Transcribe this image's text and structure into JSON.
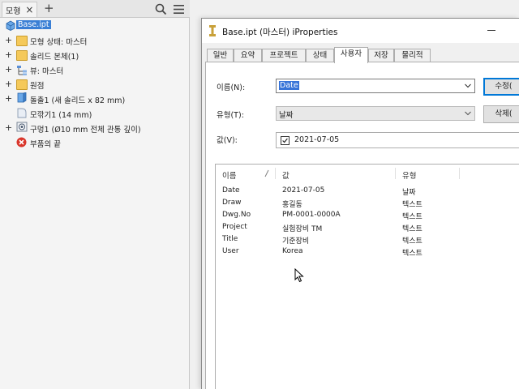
{
  "browser": {
    "tab_label": "모형",
    "close_glyph": "×",
    "add_glyph": "+",
    "tree": [
      {
        "label": "Base.ipt",
        "icon": "part-icon",
        "expander": ""
      },
      {
        "label": "모형 상태: 마스터",
        "icon": "folder-icon",
        "expander": "+"
      },
      {
        "label": "솔리드 본체(1)",
        "icon": "folder-icon",
        "expander": "+"
      },
      {
        "label": "뷰: 마스터",
        "icon": "view-icon",
        "expander": "+"
      },
      {
        "label": "원점",
        "icon": "folder-icon",
        "expander": "+"
      },
      {
        "label": "돌출1 (새 솔리드 x 82 mm)",
        "icon": "extrude-icon",
        "expander": "+"
      },
      {
        "label": "모깎기1 (14 mm)",
        "icon": "fillet-icon",
        "expander": ""
      },
      {
        "label": "구멍1 (Ø10 mm 전체 관통 깊이)",
        "icon": "hole-icon",
        "expander": "+"
      },
      {
        "label": "부품의 끝",
        "icon": "end-of-part-icon",
        "expander": ""
      }
    ]
  },
  "dialog": {
    "title": "Base.ipt (마스터) iProperties",
    "tabs": [
      "일반",
      "요약",
      "프로젝트",
      "상태",
      "사용자",
      "저장",
      "물리적"
    ],
    "active_tab": "사용자",
    "name_label": "이름(N):",
    "name_value": "Date",
    "type_label": "유형(T):",
    "type_value": "날짜",
    "value_label": "값(V):",
    "value_value": "2021-07-05",
    "modify_button": "수정(",
    "delete_button": "삭제(",
    "list": {
      "headers": [
        "이름",
        "값",
        "유형"
      ],
      "rows": [
        {
          "name": "Date",
          "value": "2021-07-05",
          "type": "날짜"
        },
        {
          "name": "Draw",
          "value": "홍길동",
          "type": "텍스트"
        },
        {
          "name": "Dwg.No",
          "value": "PM-0001-0000A",
          "type": "텍스트"
        },
        {
          "name": "Project",
          "value": "실험장비 TM",
          "type": "텍스트"
        },
        {
          "name": "Title",
          "value": "기준장비",
          "type": "텍스트"
        },
        {
          "name": "User",
          "value": "Korea",
          "type": "텍스트"
        }
      ]
    }
  },
  "colors": {
    "selection": "#3874d8",
    "folder": "#f5c95a",
    "error_red": "#d9362b"
  }
}
